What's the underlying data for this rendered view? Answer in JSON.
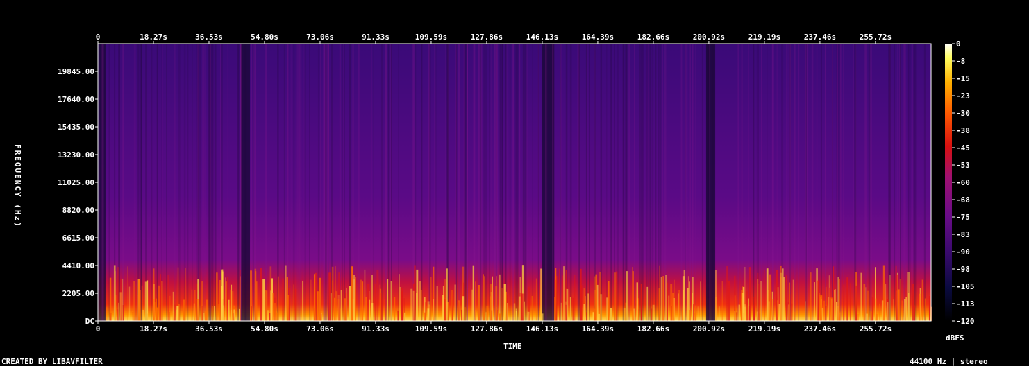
{
  "chart_data": {
    "type": "heatmap",
    "title": "",
    "xlabel": "TIME",
    "ylabel": "FREQUENCY (Hz)",
    "x_ticks": [
      "0",
      "18.27s",
      "36.53s",
      "54.80s",
      "73.06s",
      "91.33s",
      "109.59s",
      "127.86s",
      "146.13s",
      "164.39s",
      "182.66s",
      "200.92s",
      "219.19s",
      "237.46s",
      "255.72s"
    ],
    "y_ticks": [
      "DC",
      "2205.00",
      "4410.00",
      "6615.00",
      "8820.00",
      "11025.00",
      "13230.00",
      "15435.00",
      "17640.00",
      "19845.00"
    ],
    "xlim_seconds": [
      0,
      274
    ],
    "ylim_hz": [
      0,
      22050
    ],
    "colorbar": {
      "unit": "dBFS",
      "ticks": [
        "0",
        "-8",
        "-15",
        "-23",
        "-30",
        "-38",
        "-45",
        "-53",
        "-60",
        "-68",
        "-75",
        "-83",
        "-90",
        "-98",
        "-105",
        "-113",
        "-120"
      ],
      "range": [
        -120,
        0
      ],
      "colormap": [
        "#000000",
        "#0a0a40",
        "#3a0a6e",
        "#6a0c88",
        "#a01070",
        "#d81010",
        "#ff5a00",
        "#ffb000",
        "#ffff60",
        "#ffffff"
      ]
    },
    "quiet_segments_seconds": [
      [
        0,
        2.5
      ],
      [
        47,
        50
      ],
      [
        146,
        150
      ],
      [
        200,
        203
      ]
    ]
  },
  "footer": {
    "credit": "CREATED BY LIBAVFILTER",
    "sample_info": "44100 Hz | stereo"
  }
}
